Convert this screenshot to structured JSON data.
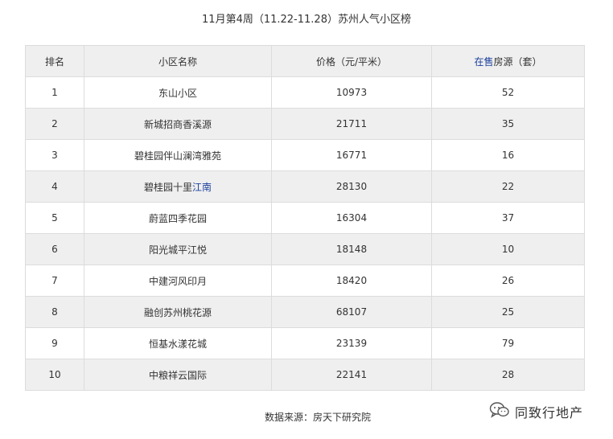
{
  "title": "11月第4周（11.22-11.28）苏州人气小区榜",
  "table": {
    "headers": {
      "rank": "排名",
      "name": "小区名称",
      "price": "价格（元/平米）",
      "listings_link": "在售",
      "listings_rest": "房源（套）"
    },
    "rows": [
      {
        "rank": "1",
        "name": "东山小区",
        "name_link": "",
        "price": "10973",
        "listings": "52"
      },
      {
        "rank": "2",
        "name": "新城招商香溪源",
        "name_link": "",
        "price": "21711",
        "listings": "35"
      },
      {
        "rank": "3",
        "name": "碧桂园伴山澜湾雅苑",
        "name_link": "",
        "price": "16771",
        "listings": "16"
      },
      {
        "rank": "4",
        "name": "碧桂园十里",
        "name_link": "江南",
        "price": "28130",
        "listings": "22"
      },
      {
        "rank": "5",
        "name": "蔚蓝四季花园",
        "name_link": "",
        "price": "16304",
        "listings": "37"
      },
      {
        "rank": "6",
        "name": "阳光城平江悦",
        "name_link": "",
        "price": "18148",
        "listings": "10"
      },
      {
        "rank": "7",
        "name": "中建河风印月",
        "name_link": "",
        "price": "18420",
        "listings": "26"
      },
      {
        "rank": "8",
        "name": "融创苏州桃花源",
        "name_link": "",
        "price": "68107",
        "listings": "25"
      },
      {
        "rank": "9",
        "name": "恒基水漾花城",
        "name_link": "",
        "price": "23139",
        "listings": "79"
      },
      {
        "rank": "10",
        "name": "中粮祥云国际",
        "name_link": "",
        "price": "22141",
        "listings": "28"
      }
    ]
  },
  "source": "数据来源：房天下研究院",
  "brand": {
    "name": "同致行地产",
    "icon": "wechat-icon"
  },
  "colors": {
    "link": "#1a3e9c",
    "stripe": "#efefef",
    "border": "#dcdcdc"
  }
}
